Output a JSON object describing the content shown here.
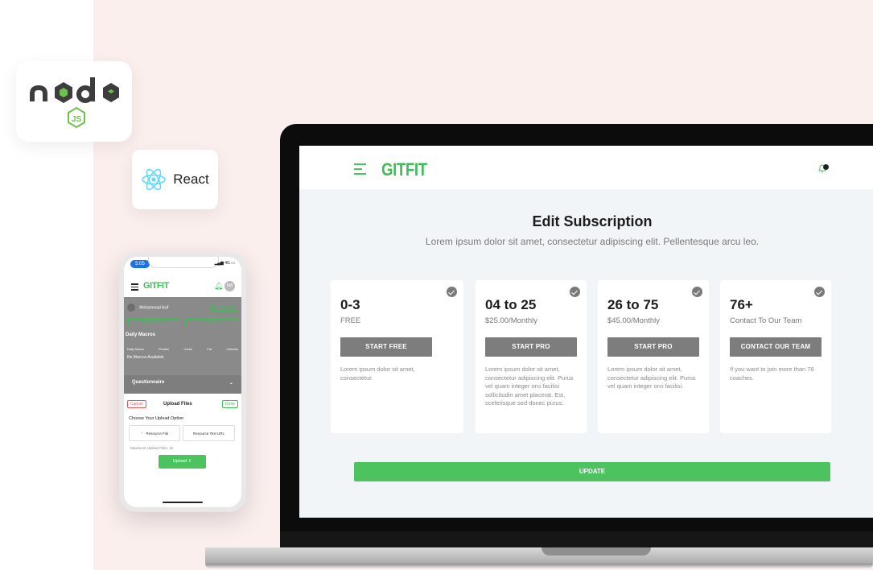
{
  "logos": {
    "node_icon": "nodejs-logo",
    "react_icon": "react-atom-icon",
    "react_label": "React"
  },
  "phone": {
    "time": "5:05",
    "signal": "4G",
    "brand": "GITFIT",
    "avatar_initials": "MA",
    "user_name": "Mohammad Asif",
    "message_label": "Message",
    "tabs": [
      "Daily Nutrition",
      "Checkins"
    ],
    "section_title": "Daily Macros",
    "macro_headers": [
      "Daily Macro",
      "Protein",
      "Carbs",
      "Fat",
      "Calories"
    ],
    "macro_empty": "No Macros Available",
    "questionnaire": "Questionnaire",
    "sheet": {
      "cancel": "Cancel",
      "title": "Upload Files",
      "done": "Done",
      "choose": "Choose Your Upload Option",
      "option_file": "Resource File",
      "option_url": "Resource Text URL",
      "max_files": "Maximum Upload Files: 10",
      "upload": "Upload"
    }
  },
  "laptop": {
    "brand": "GITFIT",
    "title": "Edit Subscription",
    "subtitle": "Lorem ipsum dolor sit amet, consectetur adipiscing elit. Pellentesque arcu leo.",
    "plans": [
      {
        "name": "0-3",
        "price": "FREE",
        "button": "START FREE",
        "desc": "Lorem ipsum dolor sit amet, consectetur."
      },
      {
        "name": "04 to 25",
        "price": "$25.00/Monthly",
        "button": "START PRO",
        "desc": "Lorem ipsum dolor sit amet, consectetur adipiscing elit. Purus vel quam integer orci facilisi sollicitudin amet placerat. Est, scelerisque sed donec purus."
      },
      {
        "name": "26 to 75",
        "price": "$45.00/Monthly",
        "button": "START PRO",
        "desc": "Lorem ipsum dolor sit amet, consectetur adipiscing elit. Purus vel quam integer orci facilisi."
      },
      {
        "name": "76+",
        "price": "Contact To Our Team",
        "button": "CONTACT OUR TEAM",
        "desc": "If you want to join more than 76 coaches."
      }
    ],
    "update_button": "UPDATE"
  },
  "colors": {
    "brand_green": "#4cc35e",
    "plan_button": "#7d7d7d",
    "background_pink": "#fbefee"
  }
}
